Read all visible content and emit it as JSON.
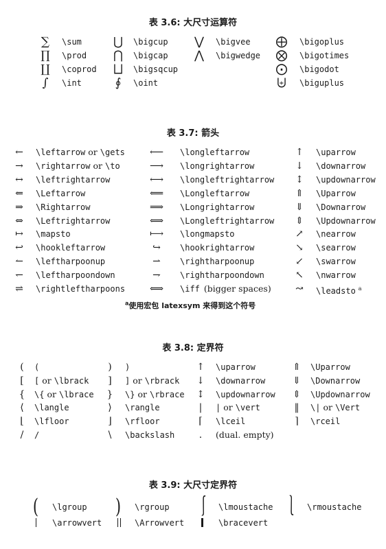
{
  "table36": {
    "caption": "表 3.6: 大尺寸运算符",
    "col1": [
      {
        "sym": "∑",
        "cmd": "\\sum"
      },
      {
        "sym": "∏",
        "cmd": "\\prod"
      },
      {
        "sym": "∐",
        "cmd": "\\coprod"
      },
      {
        "sym": "∫",
        "cmd": "\\int"
      }
    ],
    "col2": [
      {
        "sym": "⋃",
        "cmd": "\\bigcup"
      },
      {
        "sym": "⋂",
        "cmd": "\\bigcap"
      },
      {
        "sym": "⨆",
        "cmd": "\\bigsqcup"
      },
      {
        "sym": "∮",
        "cmd": "\\oint"
      }
    ],
    "col3": [
      {
        "sym": "⋁",
        "cmd": "\\bigvee"
      },
      {
        "sym": "⋀",
        "cmd": "\\bigwedge"
      }
    ],
    "col4": [
      {
        "sym": "⨁",
        "cmd": "\\bigoplus"
      },
      {
        "sym": "⨂",
        "cmd": "\\bigotimes"
      },
      {
        "sym": "⨀",
        "cmd": "\\bigodot"
      },
      {
        "sym": "⨄",
        "cmd": "\\biguplus"
      }
    ]
  },
  "table37": {
    "caption": "表 3.7: 箭头",
    "col1": [
      {
        "sym": "←",
        "cmd": "\\leftarrow",
        "or": "or",
        "alt": "\\gets"
      },
      {
        "sym": "→",
        "cmd": "\\rightarrow",
        "or": "or",
        "alt": "\\to"
      },
      {
        "sym": "↔",
        "cmd": "\\leftrightarrow"
      },
      {
        "sym": "⇐",
        "cmd": "\\Leftarrow"
      },
      {
        "sym": "⇒",
        "cmd": "\\Rightarrow"
      },
      {
        "sym": "⇔",
        "cmd": "\\Leftrightarrow"
      },
      {
        "sym": "↦",
        "cmd": "\\mapsto"
      },
      {
        "sym": "↩",
        "cmd": "\\hookleftarrow"
      },
      {
        "sym": "↼",
        "cmd": "\\leftharpoonup"
      },
      {
        "sym": "↽",
        "cmd": "\\leftharpoondown"
      },
      {
        "sym": "⇌",
        "cmd": "\\rightleftharpoons"
      }
    ],
    "col2": [
      {
        "sym": "⟵",
        "cmd": "\\longleftarrow"
      },
      {
        "sym": "⟶",
        "cmd": "\\longrightarrow"
      },
      {
        "sym": "⟷",
        "cmd": "\\longleftrightarrow"
      },
      {
        "sym": "⟸",
        "cmd": "\\Longleftarrow"
      },
      {
        "sym": "⟹",
        "cmd": "\\Longrightarrow"
      },
      {
        "sym": "⟺",
        "cmd": "\\Longleftrightarrow"
      },
      {
        "sym": "⟼",
        "cmd": "\\longmapsto"
      },
      {
        "sym": "↪",
        "cmd": "\\hookrightarrow"
      },
      {
        "sym": "⇀",
        "cmd": "\\rightharpoonup"
      },
      {
        "sym": "⇁",
        "cmd": "\\rightharpoondown"
      },
      {
        "sym": "⟺",
        "cmd": "\\iff",
        "extra": "(bigger spaces)"
      }
    ],
    "col3": [
      {
        "sym": "↑",
        "cmd": "\\uparrow"
      },
      {
        "sym": "↓",
        "cmd": "\\downarrow"
      },
      {
        "sym": "↕",
        "cmd": "\\updownarrow"
      },
      {
        "sym": "⇑",
        "cmd": "\\Uparrow"
      },
      {
        "sym": "⇓",
        "cmd": "\\Downarrow"
      },
      {
        "sym": "⇕",
        "cmd": "\\Updownarrow"
      },
      {
        "sym": "↗",
        "cmd": "\\nearrow"
      },
      {
        "sym": "↘",
        "cmd": "\\searrow"
      },
      {
        "sym": "↙",
        "cmd": "\\swarrow"
      },
      {
        "sym": "↖",
        "cmd": "\\nwarrow"
      },
      {
        "sym": "↝",
        "cmd": "\\leadsto",
        "sup": "a"
      }
    ],
    "footnote_mark": "a",
    "footnote": "使用宏包 latexsym 来得到这个符号"
  },
  "table38": {
    "caption": "表 3.8: 定界符",
    "col1": [
      {
        "sym": "(",
        "cmd": "("
      },
      {
        "sym": "[",
        "cmd": "[",
        "or": "or",
        "alt": "\\lbrack"
      },
      {
        "sym": "{",
        "cmd": "\\{",
        "or": "or",
        "alt": "\\lbrace"
      },
      {
        "sym": "⟨",
        "cmd": "\\langle"
      },
      {
        "sym": "⌊",
        "cmd": "\\lfloor"
      },
      {
        "sym": "/",
        "cmd": "/"
      }
    ],
    "col2": [
      {
        "sym": ")",
        "cmd": ")"
      },
      {
        "sym": "]",
        "cmd": "]",
        "or": "or",
        "alt": "\\rbrack"
      },
      {
        "sym": "}",
        "cmd": "\\}",
        "or": "or",
        "alt": "\\rbrace"
      },
      {
        "sym": "⟩",
        "cmd": "\\rangle"
      },
      {
        "sym": "⌋",
        "cmd": "\\rfloor"
      },
      {
        "sym": "\\",
        "cmd": "\\backslash"
      }
    ],
    "col3": [
      {
        "sym": "↑",
        "cmd": "\\uparrow"
      },
      {
        "sym": "↓",
        "cmd": "\\downarrow"
      },
      {
        "sym": "↕",
        "cmd": "\\updownarrow"
      },
      {
        "sym": "|",
        "cmd": "|",
        "or": "or",
        "alt": "\\vert"
      },
      {
        "sym": "⌈",
        "cmd": "\\lceil"
      },
      {
        "sym": ".",
        "text": "(dual. empty)"
      }
    ],
    "col4": [
      {
        "sym": "⇑",
        "cmd": "\\Uparrow"
      },
      {
        "sym": "⇓",
        "cmd": "\\Downarrow"
      },
      {
        "sym": "⇕",
        "cmd": "\\Updownarrow"
      },
      {
        "sym": "‖",
        "cmd": "\\|",
        "or": "or",
        "alt": "\\Vert"
      },
      {
        "sym": "⌉",
        "cmd": "\\rceil"
      }
    ]
  },
  "table39": {
    "caption": "表 3.9: 大尺寸定界符",
    "row1": [
      {
        "sym": "(",
        "cmd": "\\lgroup"
      },
      {
        "sym": ")",
        "cmd": "\\rgroup"
      },
      {
        "sym": "⎰",
        "cmd": "\\lmoustache"
      },
      {
        "sym": "⎱",
        "cmd": "\\rmoustache"
      }
    ],
    "row2": [
      {
        "cmd": "\\arrowvert"
      },
      {
        "cmd": "\\Arrowvert"
      },
      {
        "cmd": "\\bracevert"
      }
    ]
  }
}
